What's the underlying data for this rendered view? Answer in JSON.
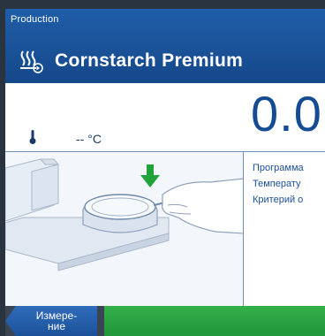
{
  "header": {
    "breadcrumb": "Production",
    "title": "Cornstarch Premium",
    "method_icon": "heating-method-icon"
  },
  "result": {
    "value": "0.0",
    "temperature": "-- °C",
    "temperature_icon": "thermometer-icon"
  },
  "info": {
    "lines": [
      "Программа",
      "Температу",
      "Критерий о"
    ]
  },
  "illustration": {
    "icon": "insert-sample-pan-illustration",
    "arrow_color": "#1fa33a"
  },
  "footer": {
    "back_label": "Измере-\nние"
  },
  "colors": {
    "header": "#1a5299",
    "accent_text": "#154c93",
    "start_button": "#28a745"
  }
}
